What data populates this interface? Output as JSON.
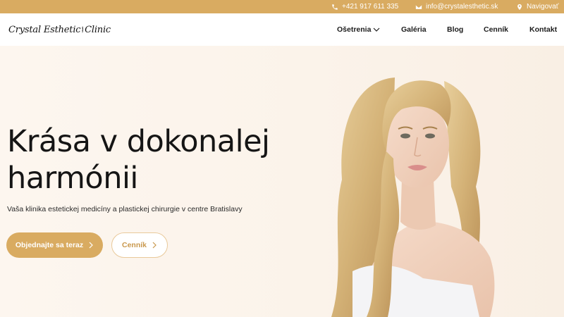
{
  "topbar": {
    "phone": "+421 917 611 335",
    "email": "info@crystalesthetic.sk",
    "navigate": "Navigovať"
  },
  "header": {
    "logo_text_left": "Crystal Esthetic",
    "logo_text_right": "Clinic",
    "nav": [
      {
        "label": "Ošetrenia",
        "has_dropdown": true
      },
      {
        "label": "Galéria"
      },
      {
        "label": "Blog"
      },
      {
        "label": "Cenník"
      },
      {
        "label": "Kontakt"
      }
    ]
  },
  "hero": {
    "title_line1": "Krása v dokonalej",
    "title_line2": "harmónii",
    "subtitle": "Vaša klinika estetickej medicíny a plastickej chirurgie v centre Bratislavy",
    "primary_button": "Objednajte sa teraz",
    "secondary_button": "Cenník"
  },
  "colors": {
    "accent": "#d9ab61",
    "hero_background": "#fbf3ea"
  },
  "icons": {
    "phone": "phone-icon",
    "email": "envelope-icon",
    "navigate": "map-pin-icon"
  }
}
